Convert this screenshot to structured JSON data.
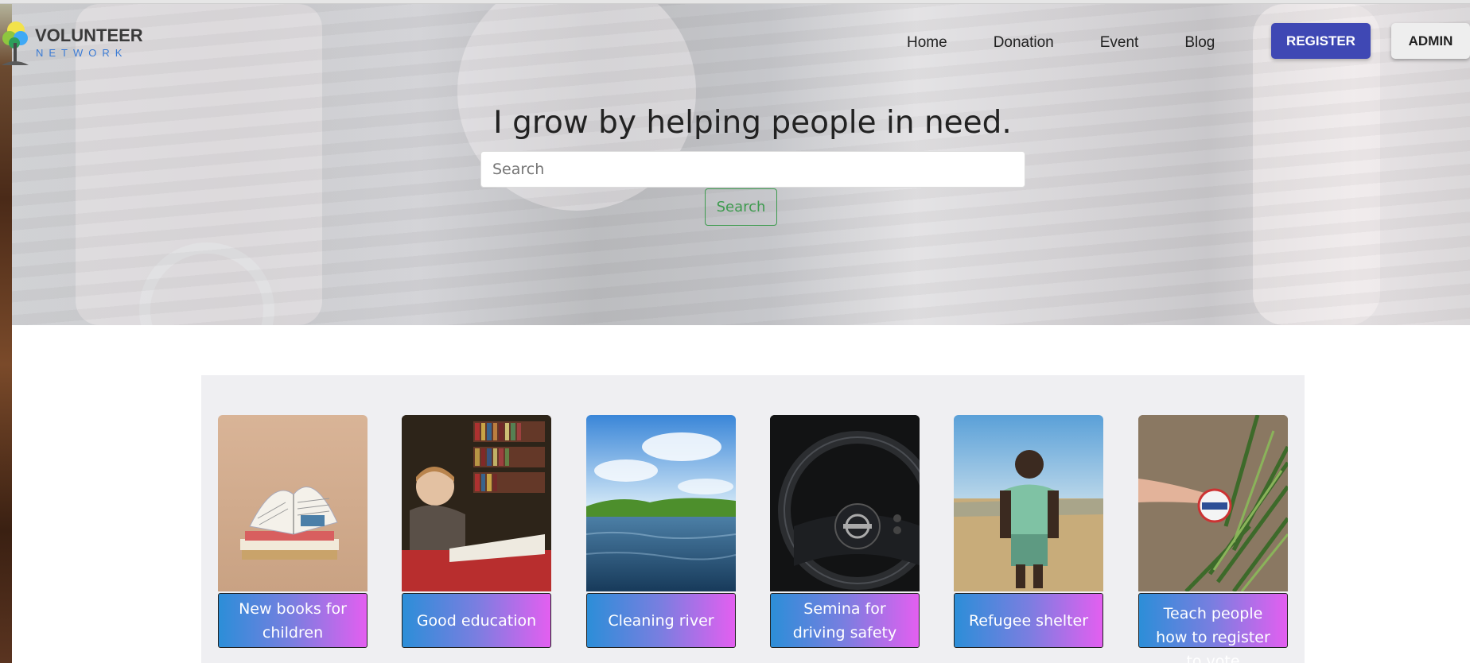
{
  "brand": {
    "name_line1": "VOLUNTEER",
    "name_line2": "NETWORK",
    "logo_icon": "tree-icon"
  },
  "nav": {
    "items": [
      {
        "label": "Home"
      },
      {
        "label": "Donation"
      },
      {
        "label": "Event"
      },
      {
        "label": "Blog"
      }
    ],
    "register_label": "REGISTER",
    "admin_label": "ADMIN"
  },
  "hero": {
    "headline": "I grow by helping people in need.",
    "search_placeholder": "Search",
    "search_button": "Search"
  },
  "events": [
    {
      "title": "New books for children",
      "image": "books-photo"
    },
    {
      "title": "Good education",
      "image": "boy-reading-photo"
    },
    {
      "title": "Cleaning river",
      "image": "river-photo"
    },
    {
      "title": "Semina for driving safety",
      "image": "steering-wheel-photo"
    },
    {
      "title": "Refugee shelter",
      "image": "child-field-photo"
    },
    {
      "title": "Teach people how to register to vote",
      "image": "i-voted-sticker-photo"
    }
  ],
  "colors": {
    "register": "#3f48b4",
    "search_accent": "#3e9b4f",
    "label_gradient_start": "#2c8ed8",
    "label_gradient_end": "#e35ff0",
    "panel": "#efeff2"
  }
}
